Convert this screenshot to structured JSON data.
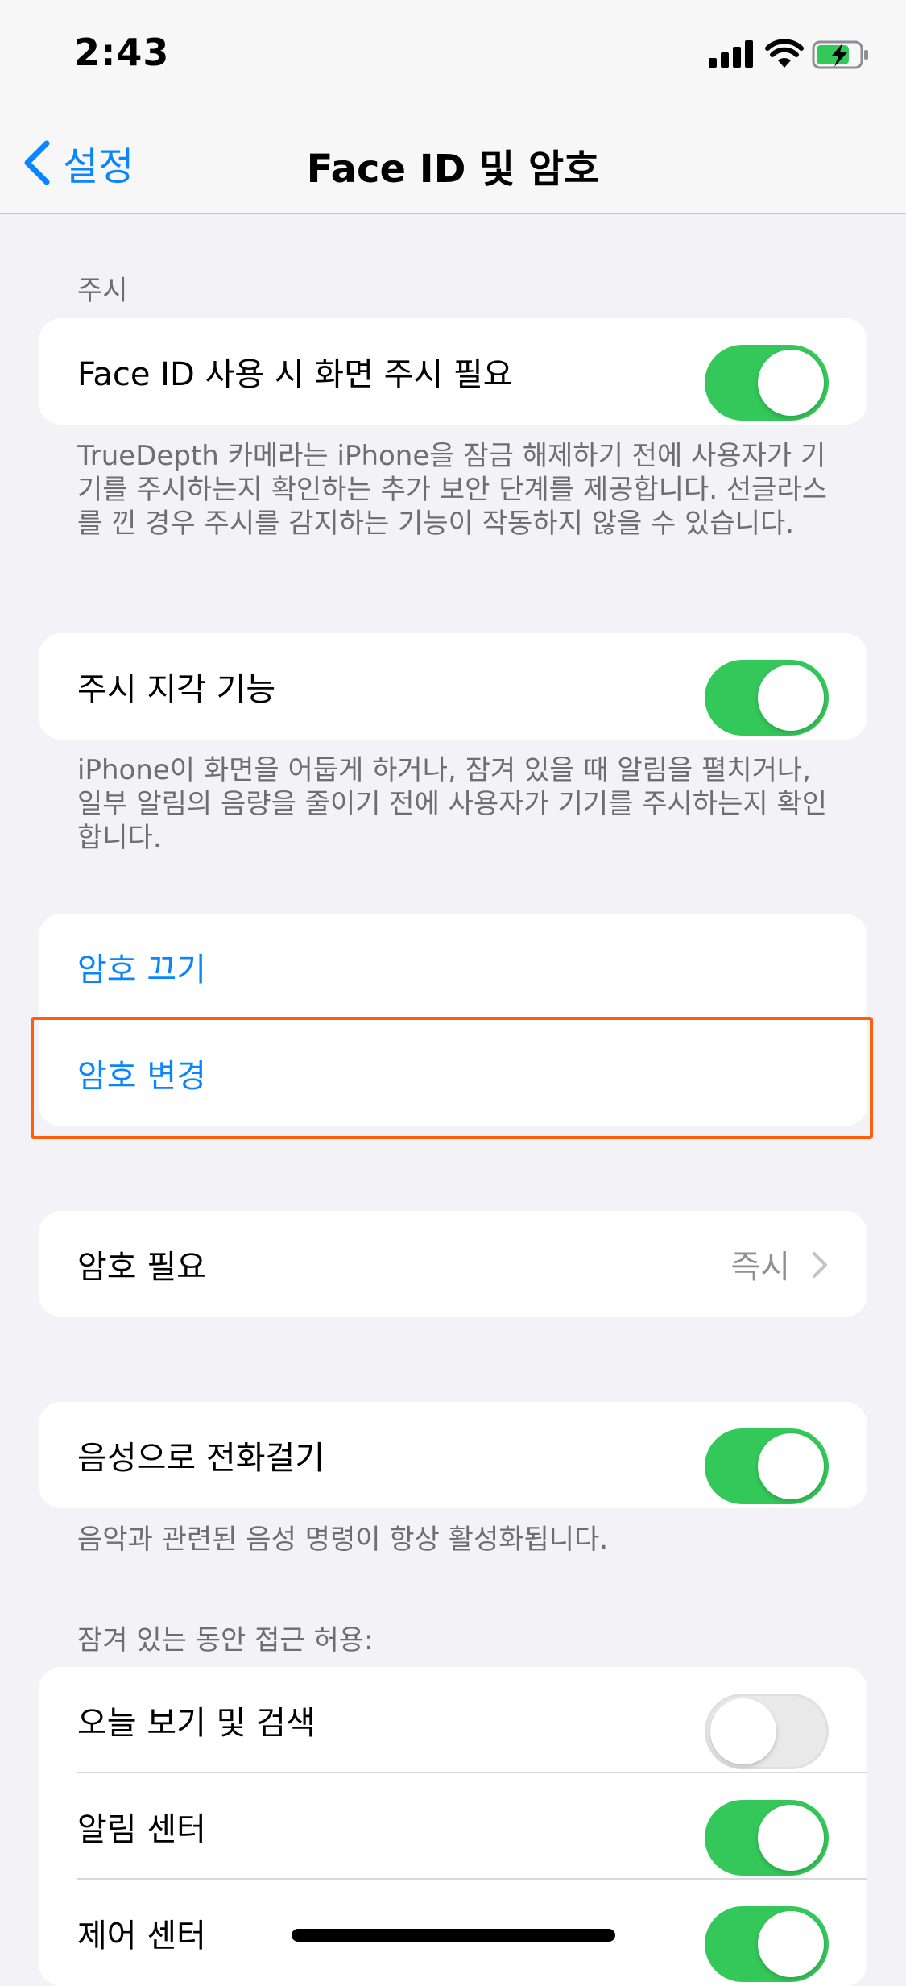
{
  "status": {
    "time": "2:43"
  },
  "nav": {
    "back_label": "설정",
    "title": "Face ID 및 암호"
  },
  "attention": {
    "header": "주시",
    "require_label": "Face ID 사용 시 화면 주시 필요",
    "require_on": true,
    "require_footer": "TrueDepth 카메라는 iPhone을 잠금 해제하기 전에 사용자가 기기를 주시하는지 확인하는 추가 보안 단계를 제공합니다. 선글라스를 낀 경우 주시를 감지하는 기능이 작동하지 않을 수 있습니다.",
    "aware_label": "주시 지각 기능",
    "aware_on": true,
    "aware_footer": "iPhone이 화면을 어둡게 하거나, 잠겨 있을 때 알림을 펼치거나, 일부 알림의 음량을 줄이기 전에 사용자가 기기를 주시하는지 확인합니다."
  },
  "passcode": {
    "turn_off_label": "암호 끄기",
    "change_label": "암호 변경",
    "require_label": "암호 필요",
    "require_value": "즉시"
  },
  "voice_dial": {
    "label": "음성으로 전화걸기",
    "on": true,
    "footer": "음악과 관련된 음성 명령이 항상 활성화됩니다."
  },
  "locked_access": {
    "header": "잠겨 있는 동안 접근 허용:",
    "items": [
      {
        "label": "오늘 보기 및 검색",
        "on": false
      },
      {
        "label": "알림 센터",
        "on": true
      },
      {
        "label": "제어 센터",
        "on": true
      }
    ]
  },
  "colors": {
    "accent": "#0a84ff",
    "toggle_on": "#34c759",
    "highlight": "#ff5f0a"
  }
}
